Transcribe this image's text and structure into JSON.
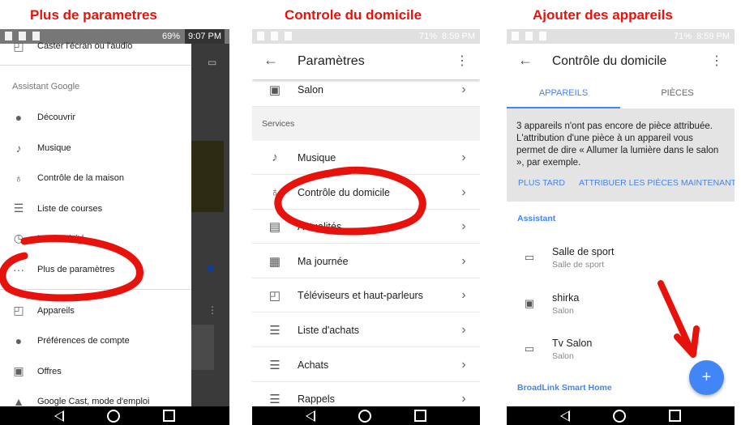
{
  "captions": [
    "Plus de parametres",
    "Controle du domicile",
    "Ajouter des appareils"
  ],
  "panel1": {
    "status": {
      "battery": "69%",
      "time": "9:07 PM"
    },
    "top_item": "Caster l'écran ou l'audio",
    "section": "Assistant Google",
    "items": [
      {
        "icon": "compass-icon",
        "label": "Découvrir"
      },
      {
        "icon": "music-note-icon",
        "label": "Musique"
      },
      {
        "icon": "lightbulb-icon",
        "label": "Contrôle de la maison"
      },
      {
        "icon": "list-icon",
        "label": "Liste de courses"
      },
      {
        "icon": "history-icon",
        "label": "Mon activité"
      },
      {
        "icon": "more-horiz-icon",
        "label": "Plus de paramètres"
      }
    ],
    "items2": [
      {
        "icon": "devices-icon",
        "label": "Appareils"
      },
      {
        "icon": "account-icon",
        "label": "Préférences de compte"
      },
      {
        "icon": "gift-icon",
        "label": "Offres"
      },
      {
        "icon": "school-icon",
        "label": "Google Cast, mode d'emploi"
      }
    ]
  },
  "panel2": {
    "status": {
      "battery": "71%",
      "time": "8:59 PM"
    },
    "title": "Paramètres",
    "top_item": "Salon",
    "section": "Services",
    "items": [
      {
        "icon": "music-note-icon",
        "label": "Musique"
      },
      {
        "icon": "lightbulb-icon",
        "label": "Contrôle du domicile"
      },
      {
        "icon": "news-icon",
        "label": "Actualités"
      },
      {
        "icon": "calendar-icon",
        "label": "Ma journée"
      },
      {
        "icon": "cast-icon",
        "label": "Téléviseurs et haut-parleurs"
      },
      {
        "icon": "list-icon",
        "label": "Liste d'achats"
      },
      {
        "icon": "list-icon",
        "label": "Achats"
      },
      {
        "icon": "list-icon",
        "label": "Rappels"
      }
    ]
  },
  "panel3": {
    "status": {
      "battery": "71%",
      "time": "8:59 PM"
    },
    "title": "Contrôle du domicile",
    "tabs": [
      "APPAREILS",
      "PIÈCES"
    ],
    "notice": "3 appareils n'ont pas encore de pièce attribuée. L'attribution d'une pièce à un appareil vous permet de dire « Allumer la lumière dans le salon », par exemple.",
    "later": "PLUS TARD",
    "assign": "ATTRIBUER LES PIÈCES MAINTENANT",
    "section": "Assistant",
    "devices": [
      {
        "icon": "tv-icon",
        "name": "Salle de sport",
        "room": "Salle de sport"
      },
      {
        "icon": "speaker-icon",
        "name": "shirka",
        "room": "Salon"
      },
      {
        "icon": "tv-icon",
        "name": "Tv Salon",
        "room": "Salon"
      }
    ],
    "section2": "BroadLink Smart Home",
    "fab": "+"
  },
  "colors": {
    "accent": "#4285f4",
    "annotation": "#e8120c"
  }
}
